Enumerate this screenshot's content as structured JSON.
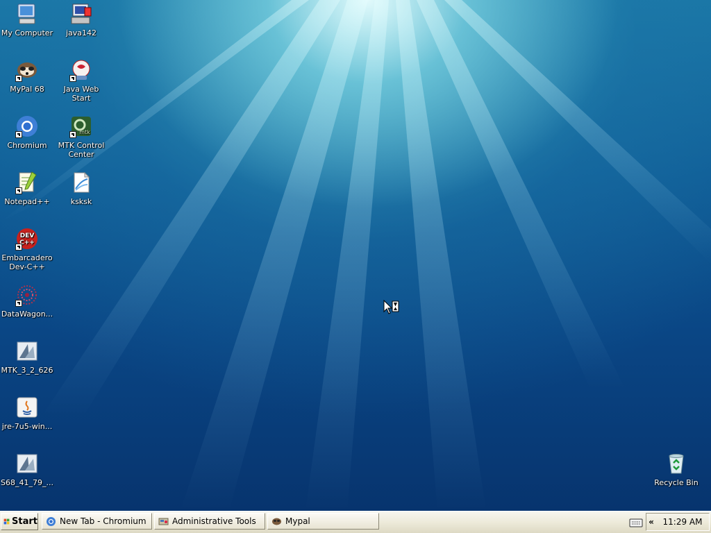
{
  "desktop": {
    "icons": [
      {
        "label": "My Computer",
        "icon": "my-computer-icon"
      },
      {
        "label": "java142",
        "icon": "java-installer-icon"
      },
      {
        "label": "MyPal 68",
        "icon": "mypal-icon"
      },
      {
        "label": "Java Web Start",
        "icon": "java-web-start-icon"
      },
      {
        "label": "Chromium",
        "icon": "chromium-icon"
      },
      {
        "label": "MTK Control Center",
        "icon": "mtk-control-center-icon"
      },
      {
        "label": "Notepad++",
        "icon": "notepadpp-icon"
      },
      {
        "label": "ksksk",
        "icon": "document-icon"
      },
      {
        "label": "Embarcadero Dev-C++",
        "icon": "devcpp-icon",
        "badge": "DEV C++"
      },
      {
        "label": "DataWagon...",
        "icon": "datawagon-icon"
      },
      {
        "label": "MTK_3_2_626",
        "icon": "mtk-installer-icon"
      },
      {
        "label": "jre-7u5-win...",
        "icon": "java-jre-icon"
      },
      {
        "label": "S68_41_79_...",
        "icon": "s68-installer-icon"
      },
      {
        "label": "Recycle Bin",
        "icon": "recycle-bin-icon"
      }
    ],
    "mtk_icon_text": "mtk"
  },
  "taskbar": {
    "start_label": "Start",
    "tasks": [
      {
        "label": "New Tab - Chromium",
        "icon": "chromium-icon"
      },
      {
        "label": "Administrative Tools",
        "icon": "admin-tools-icon"
      },
      {
        "label": "Mypal",
        "icon": "mypal-icon"
      }
    ],
    "tray_expand_label": "«",
    "clock": "11:29 AM"
  },
  "colors": {
    "desktop_top": "#1a77a6",
    "desktop_bottom": "#07346e",
    "taskbar": "#ece9d8"
  }
}
